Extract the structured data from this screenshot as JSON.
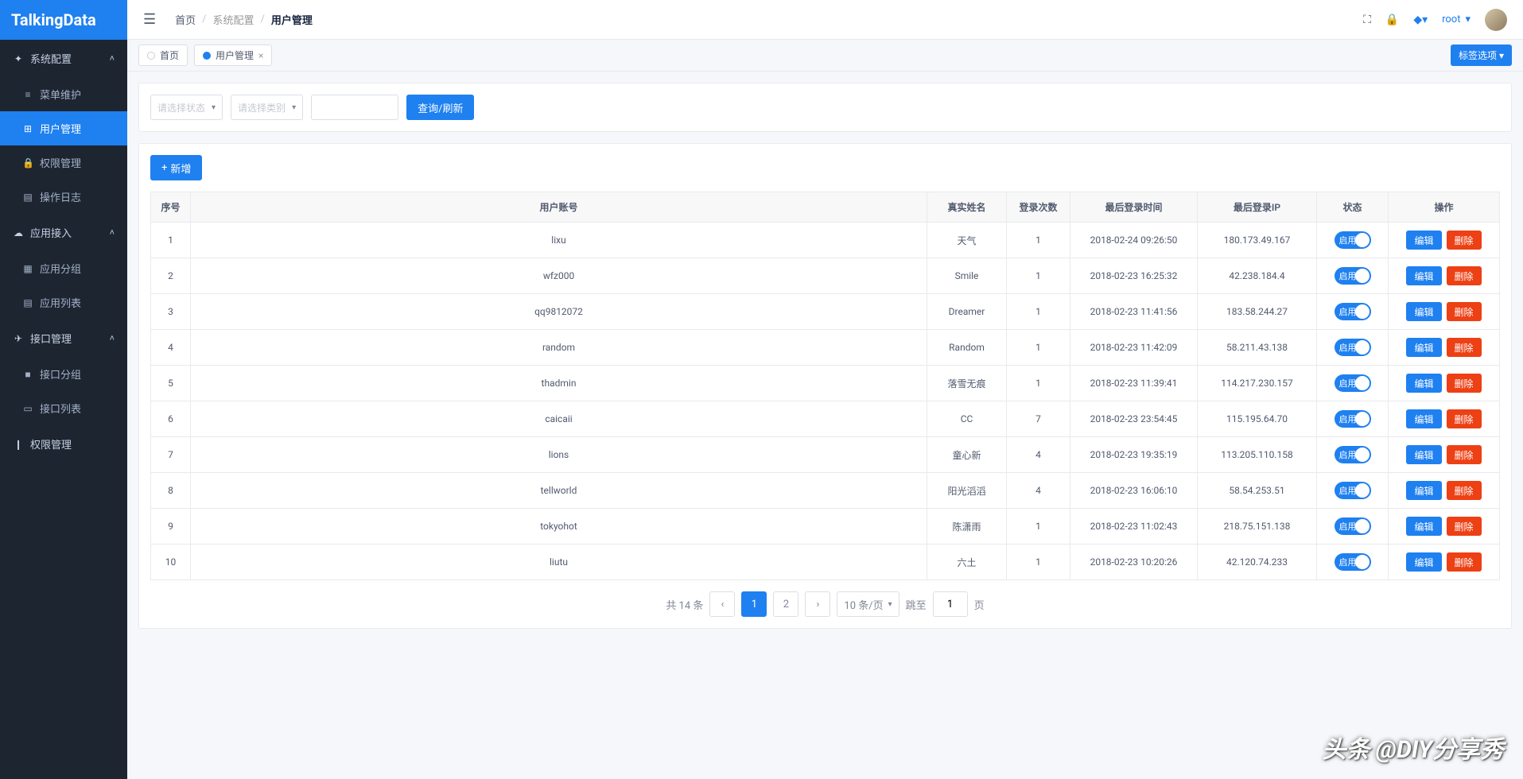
{
  "brand": "TalkingData",
  "breadcrumb": {
    "home": "首页",
    "section": "系统配置",
    "page": "用户管理"
  },
  "user": {
    "name": "root"
  },
  "sidebar": {
    "groups": [
      {
        "title": "系统配置",
        "icon": "✦",
        "items": [
          {
            "label": "菜单维护",
            "icon": "≡"
          },
          {
            "label": "用户管理",
            "icon": "⊞",
            "active": true
          },
          {
            "label": "权限管理",
            "icon": "🔒"
          },
          {
            "label": "操作日志",
            "icon": "▤"
          }
        ]
      },
      {
        "title": "应用接入",
        "icon": "☁",
        "items": [
          {
            "label": "应用分组",
            "icon": "▦"
          },
          {
            "label": "应用列表",
            "icon": "▤"
          }
        ]
      },
      {
        "title": "接口管理",
        "icon": "✈",
        "items": [
          {
            "label": "接口分组",
            "icon": "■"
          },
          {
            "label": "接口列表",
            "icon": "▭"
          }
        ]
      },
      {
        "title": "权限管理",
        "icon": "❙",
        "items": []
      }
    ]
  },
  "tabs": [
    {
      "label": "首页",
      "active": false
    },
    {
      "label": "用户管理",
      "active": true
    }
  ],
  "tab_options_label": "标签选项 ▾",
  "filters": {
    "status_placeholder": "请选择状态",
    "type_placeholder": "请选择类别",
    "search_btn": "查询/刷新"
  },
  "add_btn": "新增",
  "table": {
    "headers": [
      "序号",
      "用户账号",
      "真实姓名",
      "登录次数",
      "最后登录时间",
      "最后登录IP",
      "状态",
      "操作"
    ],
    "status_on_label": "启用",
    "edit_label": "编辑",
    "delete_label": "删除",
    "rows": [
      {
        "idx": "1",
        "account": "lixu",
        "name": "天气",
        "count": "1",
        "time": "2018-02-24 09:26:50",
        "ip": "180.173.49.167"
      },
      {
        "idx": "2",
        "account": "wfz000",
        "name": "Smile",
        "count": "1",
        "time": "2018-02-23 16:25:32",
        "ip": "42.238.184.4"
      },
      {
        "idx": "3",
        "account": "qq9812072",
        "name": "Dreamer",
        "count": "1",
        "time": "2018-02-23 11:41:56",
        "ip": "183.58.244.27"
      },
      {
        "idx": "4",
        "account": "random",
        "name": "Random",
        "count": "1",
        "time": "2018-02-23 11:42:09",
        "ip": "58.211.43.138"
      },
      {
        "idx": "5",
        "account": "thadmin",
        "name": "落雪无痕",
        "count": "1",
        "time": "2018-02-23 11:39:41",
        "ip": "114.217.230.157"
      },
      {
        "idx": "6",
        "account": "caicaii",
        "name": "CC",
        "count": "7",
        "time": "2018-02-23 23:54:45",
        "ip": "115.195.64.70"
      },
      {
        "idx": "7",
        "account": "lions",
        "name": "童心新",
        "count": "4",
        "time": "2018-02-23 19:35:19",
        "ip": "113.205.110.158"
      },
      {
        "idx": "8",
        "account": "tellworld",
        "name": "阳光滔滔",
        "count": "4",
        "time": "2018-02-23 16:06:10",
        "ip": "58.54.253.51"
      },
      {
        "idx": "9",
        "account": "tokyohot",
        "name": "陈潇雨",
        "count": "1",
        "time": "2018-02-23 11:02:43",
        "ip": "218.75.151.138"
      },
      {
        "idx": "10",
        "account": "liutu",
        "name": "六土",
        "count": "1",
        "time": "2018-02-23 10:20:26",
        "ip": "42.120.74.233"
      }
    ]
  },
  "pagination": {
    "total_label": "共 14 条",
    "pages": [
      "1",
      "2"
    ],
    "per_page": "10 条/页",
    "jump_label": "跳至",
    "jump_value": "1",
    "page_suffix": "页"
  },
  "watermark": "头条 @DIY分享秀"
}
